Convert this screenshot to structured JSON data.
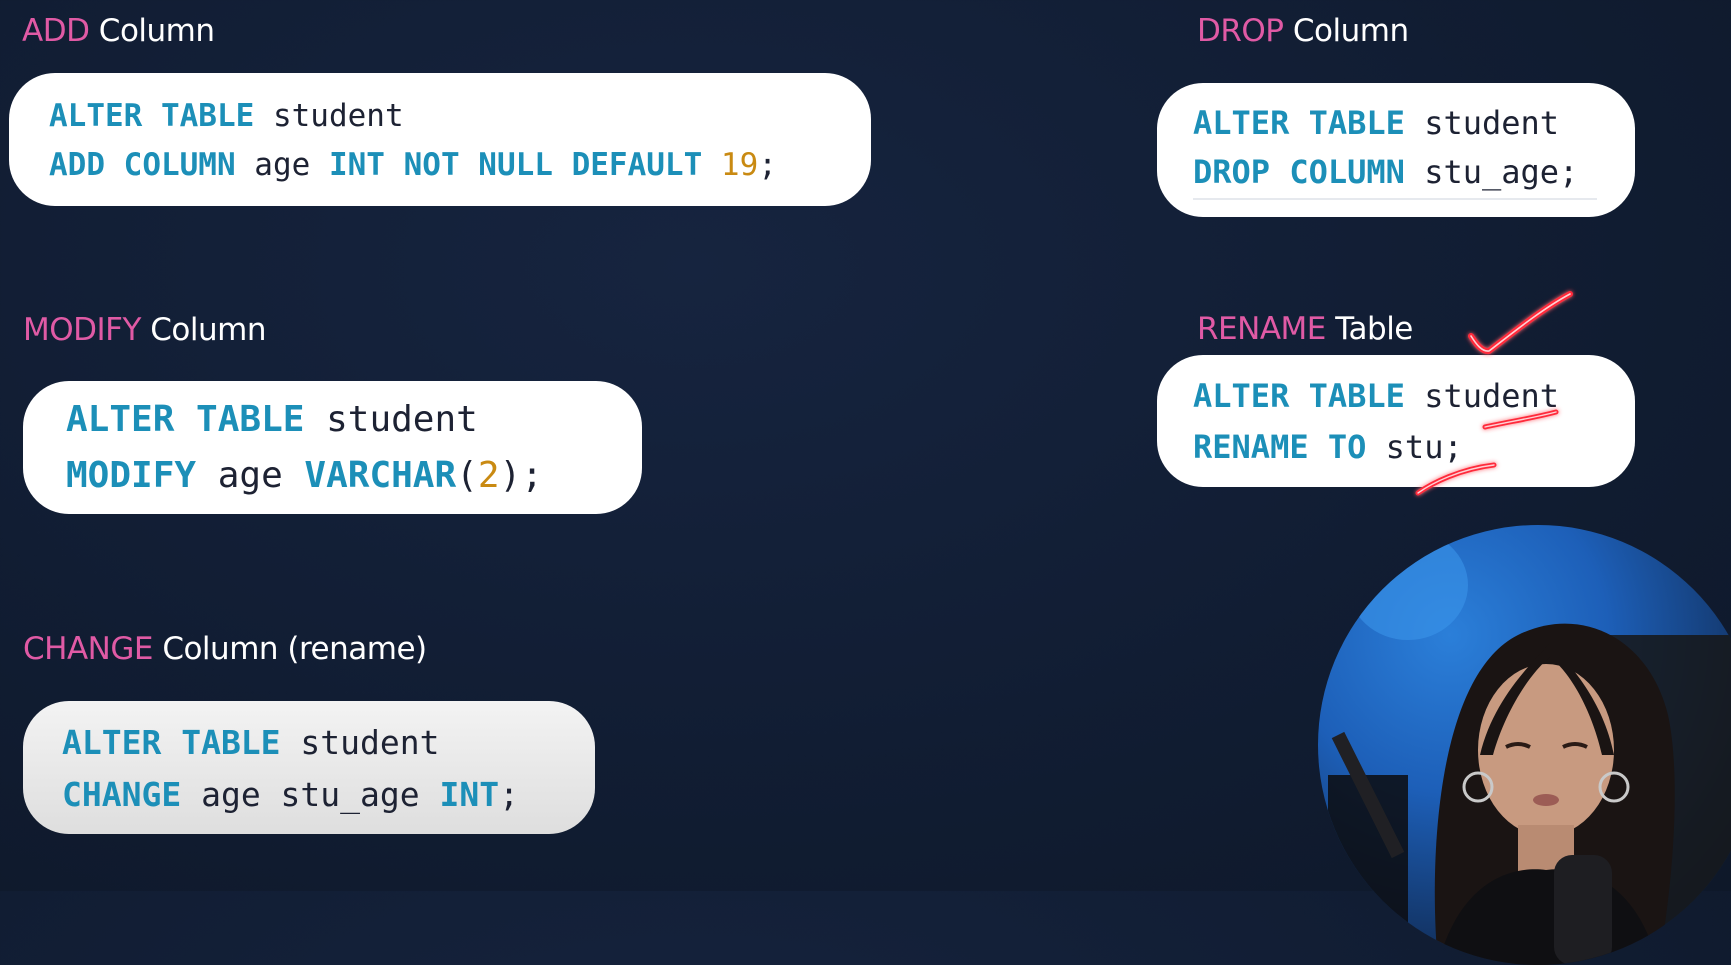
{
  "sections": {
    "add": {
      "keyword": "ADD",
      "rest": " Column",
      "line1": {
        "k1": "ALTER TABLE",
        "t1": " student"
      },
      "line2": {
        "k1": "ADD COLUMN",
        "t1": " age ",
        "k2": "INT NOT NULL DEFAULT",
        "t2": " ",
        "n1": "19",
        "t3": ";"
      }
    },
    "modify": {
      "keyword": "MODIFY",
      "rest": " Column",
      "line1": {
        "k1": "ALTER TABLE",
        "t1": " student"
      },
      "line2": {
        "k1": "MODIFY",
        "t1": " age ",
        "k2": "VARCHAR",
        "t2": "(",
        "n1": "2",
        "t3": ");"
      }
    },
    "change": {
      "keyword": "CHANGE",
      "rest": " Column (rename)",
      "line1": {
        "k1": "ALTER TABLE",
        "t1": " student"
      },
      "line2": {
        "k1": "CHANGE",
        "t1": " age stu_age ",
        "k2": "INT",
        "t2": ";"
      }
    },
    "drop": {
      "keyword": "DROP",
      "rest": " Column",
      "line1": {
        "k1": "ALTER TABLE",
        "t1": " student"
      },
      "line2": {
        "k1": "DROP COLUMN",
        "t1": " stu_age;"
      }
    },
    "rename": {
      "keyword": "RENAME",
      "rest": " Table",
      "line1": {
        "k1": "ALTER TABLE",
        "t1": " student"
      },
      "line2": {
        "k1": "RENAME TO",
        "t1": " stu;"
      }
    }
  },
  "colors": {
    "background": "#111d33",
    "heading_keyword": "#e05aa5",
    "heading_text": "#ffffff",
    "sql_keyword": "#1c8fb8",
    "sql_number": "#c98a12",
    "sql_text": "#1d2233",
    "card": "#ffffff",
    "annotation": "#ff2a3a"
  },
  "icons": {
    "annotation_check": "checkmark-icon",
    "webcam": "presenter-webcam"
  }
}
